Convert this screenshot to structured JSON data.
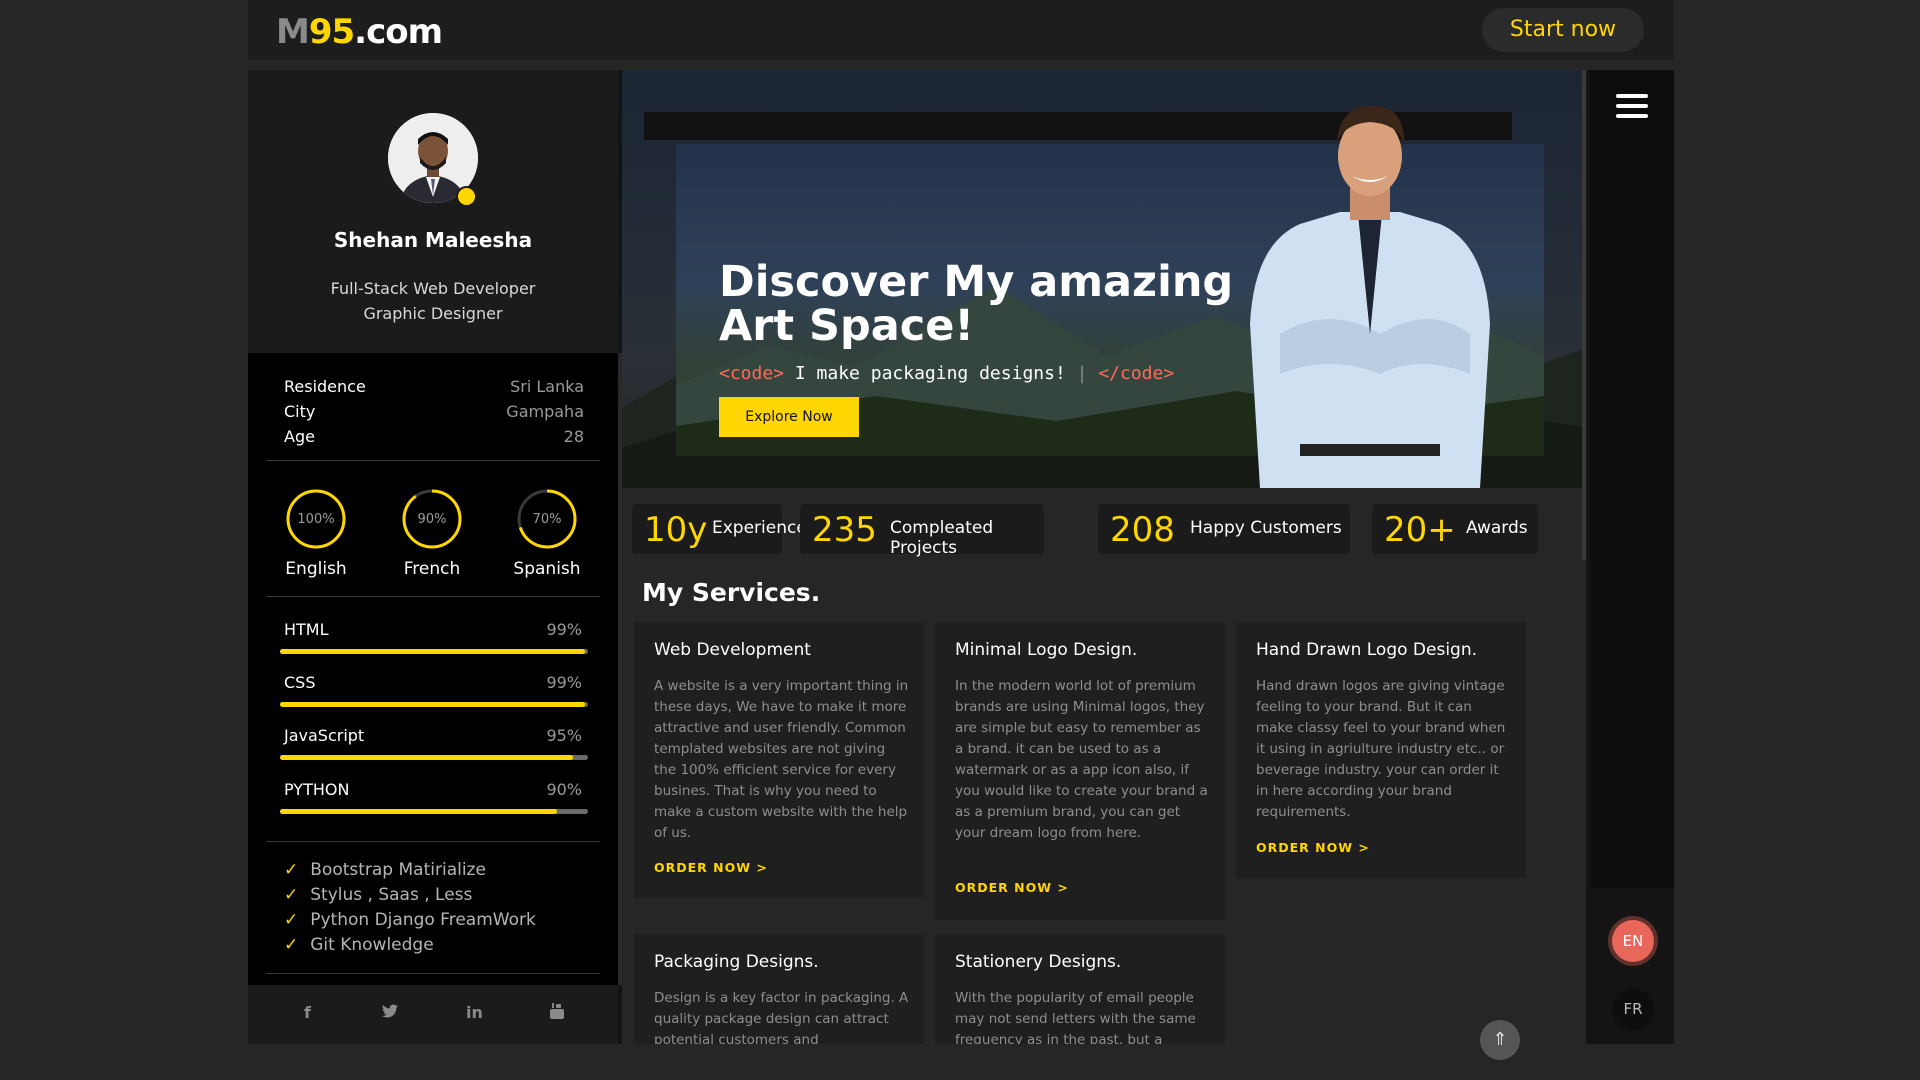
{
  "topbar": {
    "logo_m": "M",
    "logo_num": "95",
    "logo_dom": ".com",
    "start_label": "Start now"
  },
  "profile": {
    "name": "Shehan Maleesha",
    "role1": "Full-Stack Web Developer",
    "role2": "Graphic Designer"
  },
  "info": [
    {
      "key": "Residence",
      "value": "Sri Lanka"
    },
    {
      "key": "City",
      "value": "Gampaha"
    },
    {
      "key": "Age",
      "value": "28"
    }
  ],
  "languages": [
    {
      "name": "English",
      "percent": "100%",
      "level": 1.0
    },
    {
      "name": "French",
      "percent": "90%",
      "level": 0.9
    },
    {
      "name": "Spanish",
      "percent": "70%",
      "level": 0.7
    }
  ],
  "skills": [
    {
      "name": "HTML",
      "percent": "99%",
      "level": 0.99
    },
    {
      "name": "CSS",
      "percent": "99%",
      "level": 0.99
    },
    {
      "name": "JavaScript",
      "percent": "95%",
      "level": 0.95
    },
    {
      "name": "PYTHON",
      "percent": "90%",
      "level": 0.9
    }
  ],
  "knowledge": [
    "Bootstrap Matirialize",
    "Stylus , Saas , Less",
    "Python Django FreamWork",
    "Git Knowledge"
  ],
  "social_icons": [
    "facebook-icon",
    "twitter-icon",
    "linkedin-icon",
    "youtube-icon"
  ],
  "hero": {
    "title_line1": "Discover My amazing",
    "title_line2": "Art Space!",
    "code_open": "<code>",
    "code_text": " I make packaging designs!",
    "code_close": "</code>",
    "explore_label": "Explore Now"
  },
  "stats": [
    {
      "num": "10y",
      "label": "Experience"
    },
    {
      "num": "235",
      "label": "Compleated Projects"
    },
    {
      "num": "208",
      "label": "Happy Customers"
    },
    {
      "num": "20+",
      "label": "Awards"
    }
  ],
  "services_title": "My Services.",
  "services": [
    {
      "title": "Web Development",
      "desc": "A website is a very important thing in these days, We have to make it more attractive and user friendly. Common templated websites are not giving the 100% efficient service for every busines. That is why you need to make a custom website with the help of us.",
      "order": "ORDER NOW >"
    },
    {
      "title": "Minimal Logo Design.",
      "desc": "In the modern world lot of premium brands are using Minimal logos, they are simple but easy to remember as a brand. it can be used to as a watermark or as a app icon also, if you would like to create your brand a as a premium brand, you can get your dream logo from here.",
      "order": "ORDER NOW >"
    },
    {
      "title": "Hand Drawn Logo Design.",
      "desc": "Hand drawn logos are giving vintage feeling to your brand. But it can make classy feel to your brand when it using in agriulture industry etc.. or beverage industry. your can order it in here according your brand requirements.",
      "order": "ORDER NOW >"
    },
    {
      "title": "Packaging Designs.",
      "desc": "Design is a key factor in packaging. A quality package design can attract potential customers and"
    },
    {
      "title": "Stationery Designs.",
      "desc": "With the popularity of email people may not send letters with the same frequency as in the past, but a"
    }
  ],
  "rail": {
    "lang_en": "EN",
    "lang_fr": "FR"
  },
  "colors": {
    "accent": "#ffd600",
    "background": "#262626",
    "lang_active": "#e8665a"
  }
}
